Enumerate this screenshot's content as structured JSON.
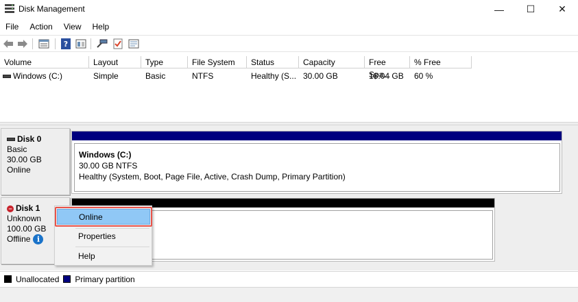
{
  "window": {
    "title": "Disk Management"
  },
  "window_controls": {
    "minimize": "—",
    "maximize": "☐",
    "close": "✕"
  },
  "menu": [
    "File",
    "Action",
    "View",
    "Help"
  ],
  "toolbar_icons": [
    "back-icon",
    "forward-icon",
    "list-view-icon",
    "help-icon",
    "graph-view-icon",
    "connect-icon",
    "check-icon",
    "properties-icon"
  ],
  "volume_table": {
    "columns": [
      "Volume",
      "Layout",
      "Type",
      "File System",
      "Status",
      "Capacity",
      "Free Spa...",
      "% Free"
    ],
    "rows": [
      {
        "volume": "Windows (C:)",
        "layout": "Simple",
        "type": "Basic",
        "file_system": "NTFS",
        "status": "Healthy (S...",
        "capacity": "30.00 GB",
        "free_space": "18.04 GB",
        "percent_free": "60 %"
      }
    ]
  },
  "disks": [
    {
      "name": "Disk 0",
      "type": "Basic",
      "size": "30.00 GB",
      "state": "Online",
      "volume": {
        "name": "Windows  (C:)",
        "size_fs": "30.00 GB NTFS",
        "health": "Healthy (System, Boot, Page File, Active, Crash Dump, Primary Partition)"
      }
    },
    {
      "name": "Disk 1",
      "type": "Unknown",
      "size": "100.00 GB",
      "state": "Offline"
    }
  ],
  "context_menu": [
    "Online",
    "Properties",
    "Help"
  ],
  "legend": [
    {
      "label": "Unallocated",
      "color": "#000000"
    },
    {
      "label": "Primary partition",
      "color": "#00007f"
    }
  ],
  "colors": {
    "primary_partition": "#00007f",
    "unallocated": "#000000",
    "highlight": "#e8534a"
  }
}
